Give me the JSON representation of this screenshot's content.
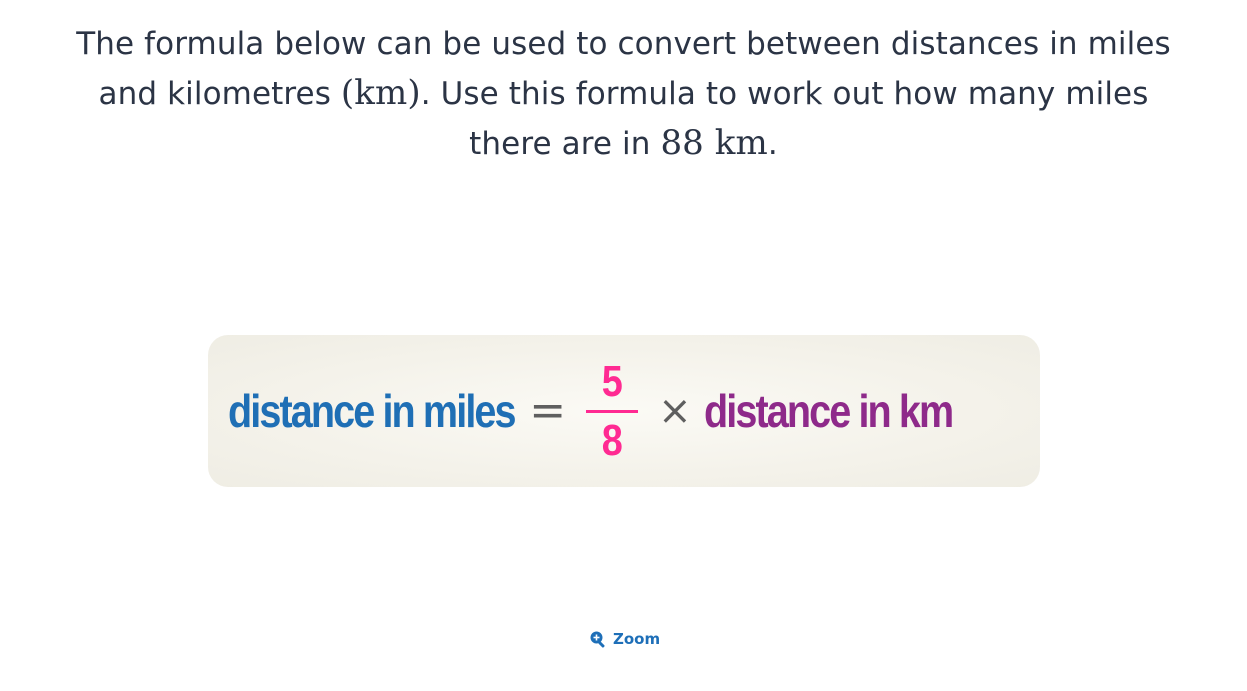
{
  "question": {
    "line1": "The formula below can be used to convert between distances in miles",
    "line2_pre": "and kilometres ",
    "line2_math": "(km)",
    "line2_post": ". Use this formula to work out how many miles",
    "line3_pre": "there are in ",
    "line3_math": "88 km",
    "line3_post": "."
  },
  "formula": {
    "left_term": "distance in miles",
    "equals": "=",
    "numerator": "5",
    "denominator": "8",
    "times": "×",
    "right_term": "distance in km"
  },
  "zoom": {
    "label": "Zoom",
    "icon": "zoom-in-icon"
  },
  "colors": {
    "text": "#2b3445",
    "left_term": "#1f6fb5",
    "fraction": "#ff2a92",
    "right_term": "#8e2a8a",
    "link": "#1e6fb8"
  }
}
